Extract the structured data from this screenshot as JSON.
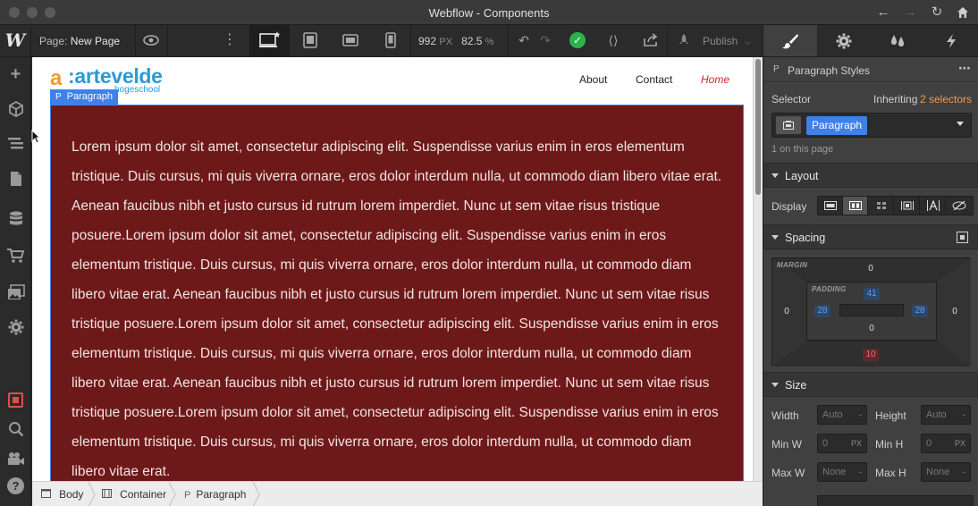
{
  "window": {
    "title": "Webflow - Components"
  },
  "toolbar": {
    "logo": "W",
    "page_label": "Page:",
    "page_name": "New Page",
    "width_value": "992",
    "width_unit": "PX",
    "zoom_value": "82.5",
    "zoom_unit": "%",
    "publish_label": "Publish"
  },
  "canvas": {
    "logo_mark": "a",
    "logo_name": ":artevelde",
    "logo_sub": "hogeschool",
    "nav": [
      {
        "label": "About"
      },
      {
        "label": "Contact"
      },
      {
        "label": "Home",
        "active": true
      }
    ],
    "selection_badge": {
      "icon": "P",
      "label": "Paragraph"
    },
    "paragraph_text": "Lorem ipsum dolor sit amet, consectetur adipiscing elit. Suspendisse varius enim in eros elementum tristique. Duis cursus, mi quis viverra ornare, eros dolor interdum nulla, ut commodo diam libero vitae erat. Aenean faucibus nibh et justo cursus id rutrum lorem imperdiet. Nunc ut sem vitae risus tristique posuere.Lorem ipsum dolor sit amet, consectetur adipiscing elit. Suspendisse varius enim in eros elementum tristique. Duis cursus, mi quis viverra ornare, eros dolor interdum nulla, ut commodo diam libero vitae erat. Aenean faucibus nibh et justo cursus id rutrum lorem imperdiet. Nunc ut sem vitae risus tristique posuere.Lorem ipsum dolor sit amet, consectetur adipiscing elit. Suspendisse varius enim in eros elementum tristique. Duis cursus, mi quis viverra ornare, eros dolor interdum nulla, ut commodo diam libero vitae erat. Aenean faucibus nibh et justo cursus id rutrum lorem imperdiet. Nunc ut sem vitae risus tristique posuere.Lorem ipsum dolor sit amet, consectetur adipiscing elit. Suspendisse varius enim in eros elementum tristique. Duis cursus, mi quis viverra ornare, eros dolor interdum nulla, ut commodo diam libero vitae erat.",
    "background_color": "#6e1919"
  },
  "breadcrumb": {
    "items": [
      {
        "icon": "body-icon",
        "label": "Body"
      },
      {
        "icon": "container-icon",
        "label": "Container"
      },
      {
        "icon": "P",
        "label": "Paragraph"
      }
    ]
  },
  "panel": {
    "header_icon": "P",
    "header_title": "Paragraph Styles",
    "selector_label": "Selector",
    "inheriting_text": "Inheriting",
    "inheriting_count": "2 selectors",
    "selector_tag": "Paragraph",
    "on_page_text": "1 on this page",
    "sections": {
      "layout": "Layout",
      "spacing": "Spacing",
      "size": "Size"
    },
    "display_label": "Display",
    "spacing": {
      "margin_label": "MARGIN",
      "padding_label": "PADDING",
      "margin_top": "0",
      "margin_left": "0",
      "margin_right": "0",
      "margin_bottom": "10",
      "padding_top": "41",
      "padding_left": "28",
      "padding_right": "28",
      "padding_bottom": "0"
    },
    "size": {
      "width_label": "Width",
      "width_value": "Auto",
      "height_label": "Height",
      "height_value": "Auto",
      "minw_label": "Min W",
      "minw_value": "0",
      "minw_unit": "PX",
      "minh_label": "Min H",
      "minh_value": "0",
      "minh_unit": "PX",
      "maxw_label": "Max W",
      "maxw_value": "None",
      "maxh_label": "Max H",
      "maxh_value": "None"
    }
  },
  "colors": {
    "accent": "#3f80ea",
    "published_check": "#2bb34a",
    "inheriting_highlight": "#f2994a"
  }
}
